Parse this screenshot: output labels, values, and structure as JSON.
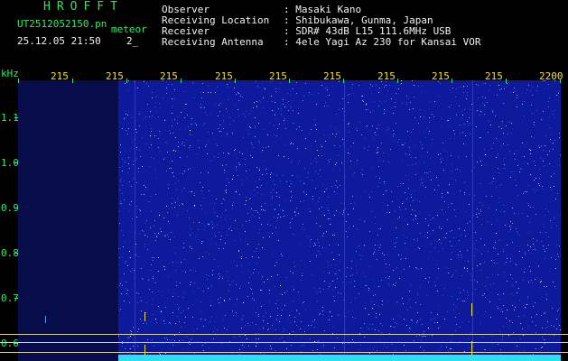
{
  "header": {
    "logo": "HROFFT",
    "filename": "UT2512052150.pn",
    "meteor": "meteor",
    "timestamp": "25.12.05 21:50",
    "counter": "2_",
    "info": [
      {
        "label": "Observer",
        "value": ": Masaki Kano"
      },
      {
        "label": "Receiving Location",
        "value": ": Shibukawa, Gunma, Japan"
      },
      {
        "label": "Receiver",
        "value": ": SDR# 43dB L15 111.6MHz USB"
      },
      {
        "label": "Receiving Antenna",
        "value": ": 4ele Yagi Az 230 for Kansai VOR"
      }
    ]
  },
  "axis": {
    "y_unit": "kHz",
    "x_ticks": [
      "215",
      "215",
      "215",
      "215",
      "215",
      "215",
      "215",
      "215",
      "215",
      "2200"
    ],
    "y_ticks": [
      "1.1",
      "1.0",
      "0.9",
      "0.8",
      "0.7",
      "0.6"
    ]
  },
  "colors": {
    "background": "#000000",
    "waterfall": "#0d1a9c",
    "tick_text": "#f0e030",
    "header_text": "#f2f2f2",
    "label_text": "#35e86a",
    "signal": "#29e0f0"
  }
}
